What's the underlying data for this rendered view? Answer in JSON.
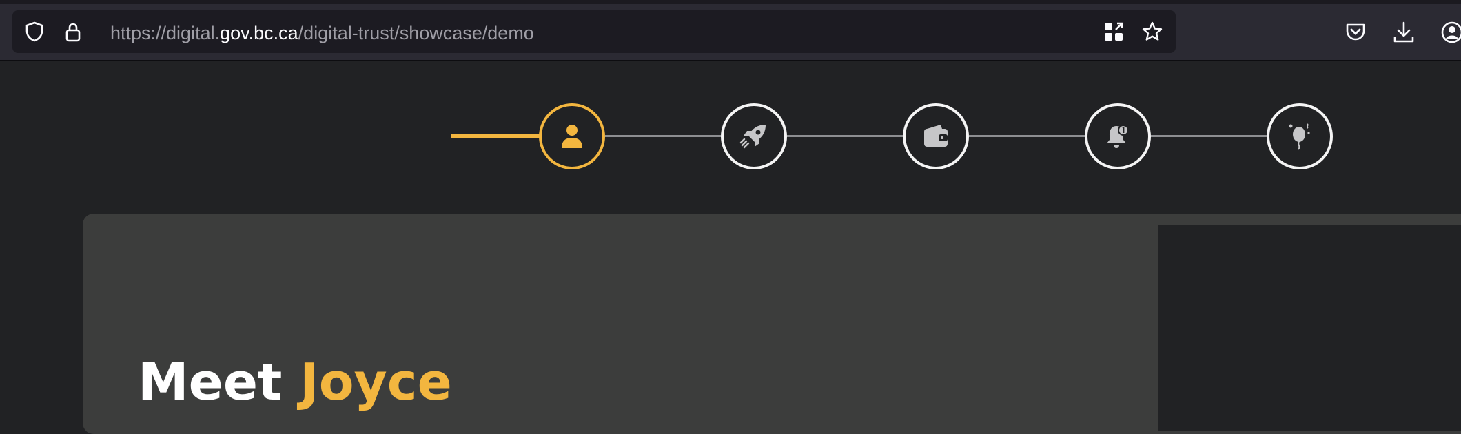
{
  "browser": {
    "url": {
      "prefix": "https://digital.",
      "host": "gov.bc.ca",
      "path": "/digital-trust/showcase/demo"
    },
    "icons": [
      "shield-icon",
      "lock-icon",
      "qr-code-icon",
      "star-icon",
      "pocket-icon",
      "download-icon",
      "account-icon"
    ]
  },
  "stepper": {
    "steps": [
      {
        "icon": "person-icon",
        "state": "active"
      },
      {
        "icon": "rocket-icon",
        "state": "inactive"
      },
      {
        "icon": "wallet-icon",
        "state": "inactive"
      },
      {
        "icon": "bell-notification-icon",
        "state": "inactive"
      },
      {
        "icon": "balloon-icon",
        "state": "inactive"
      }
    ],
    "colors": {
      "active": "#f3b63f",
      "inactive": "#f5f5f5",
      "line": "#8d8e91"
    }
  },
  "intro": {
    "heading_prefix": "Meet ",
    "heading_name": "Joyce"
  },
  "colors": {
    "accent": "#f3b63f",
    "background": "#212224",
    "card": "#3c3d3c"
  }
}
